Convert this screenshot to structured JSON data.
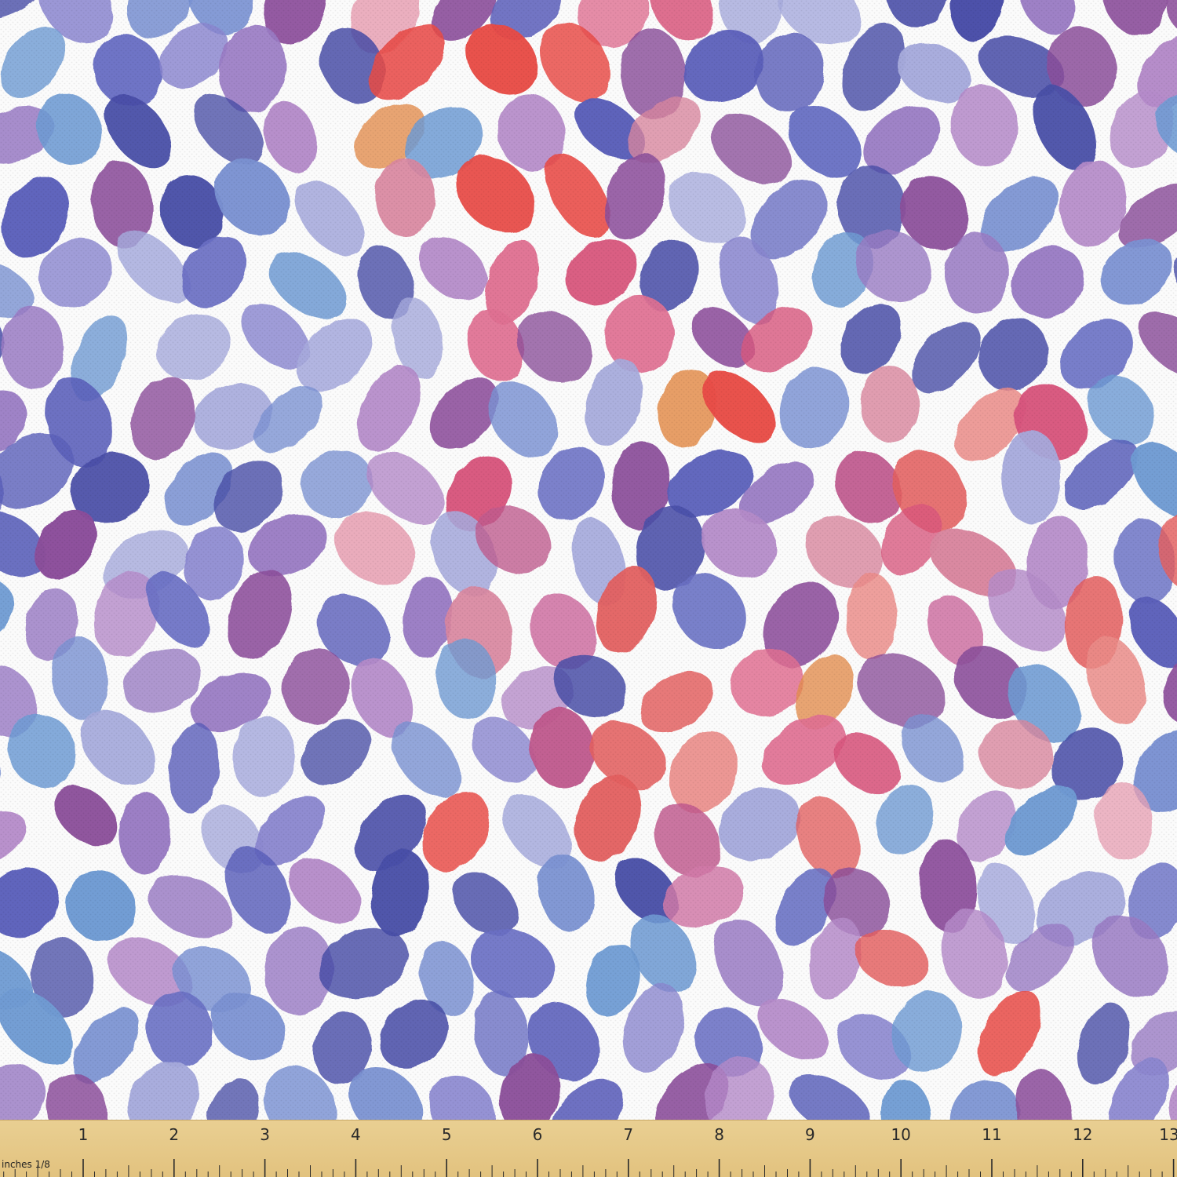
{
  "ruler": {
    "unit_label": "inches  1/8",
    "numbers": [
      "1",
      "2",
      "3",
      "4",
      "5",
      "6",
      "7",
      "8",
      "9",
      "10",
      "11",
      "12",
      "13"
    ]
  },
  "palette": {
    "background": "#fbfbfb",
    "swatches": [
      "#4a4fa8",
      "#6a70c4",
      "#6f9bd3",
      "#8a86cf",
      "#9a7cc4",
      "#b58bc9",
      "#8c4f9b",
      "#c05a8e",
      "#d8577e",
      "#e07092",
      "#d9879f",
      "#ea8c88",
      "#e8a3b5",
      "#e36060",
      "#e84b46",
      "#e38d4c",
      "#d17aa8",
      "#5b5fba",
      "#7b92d2",
      "#a6aadc"
    ]
  },
  "ruler_colors": {
    "wood": "#e6c888",
    "ink": "#2a2a2a"
  }
}
